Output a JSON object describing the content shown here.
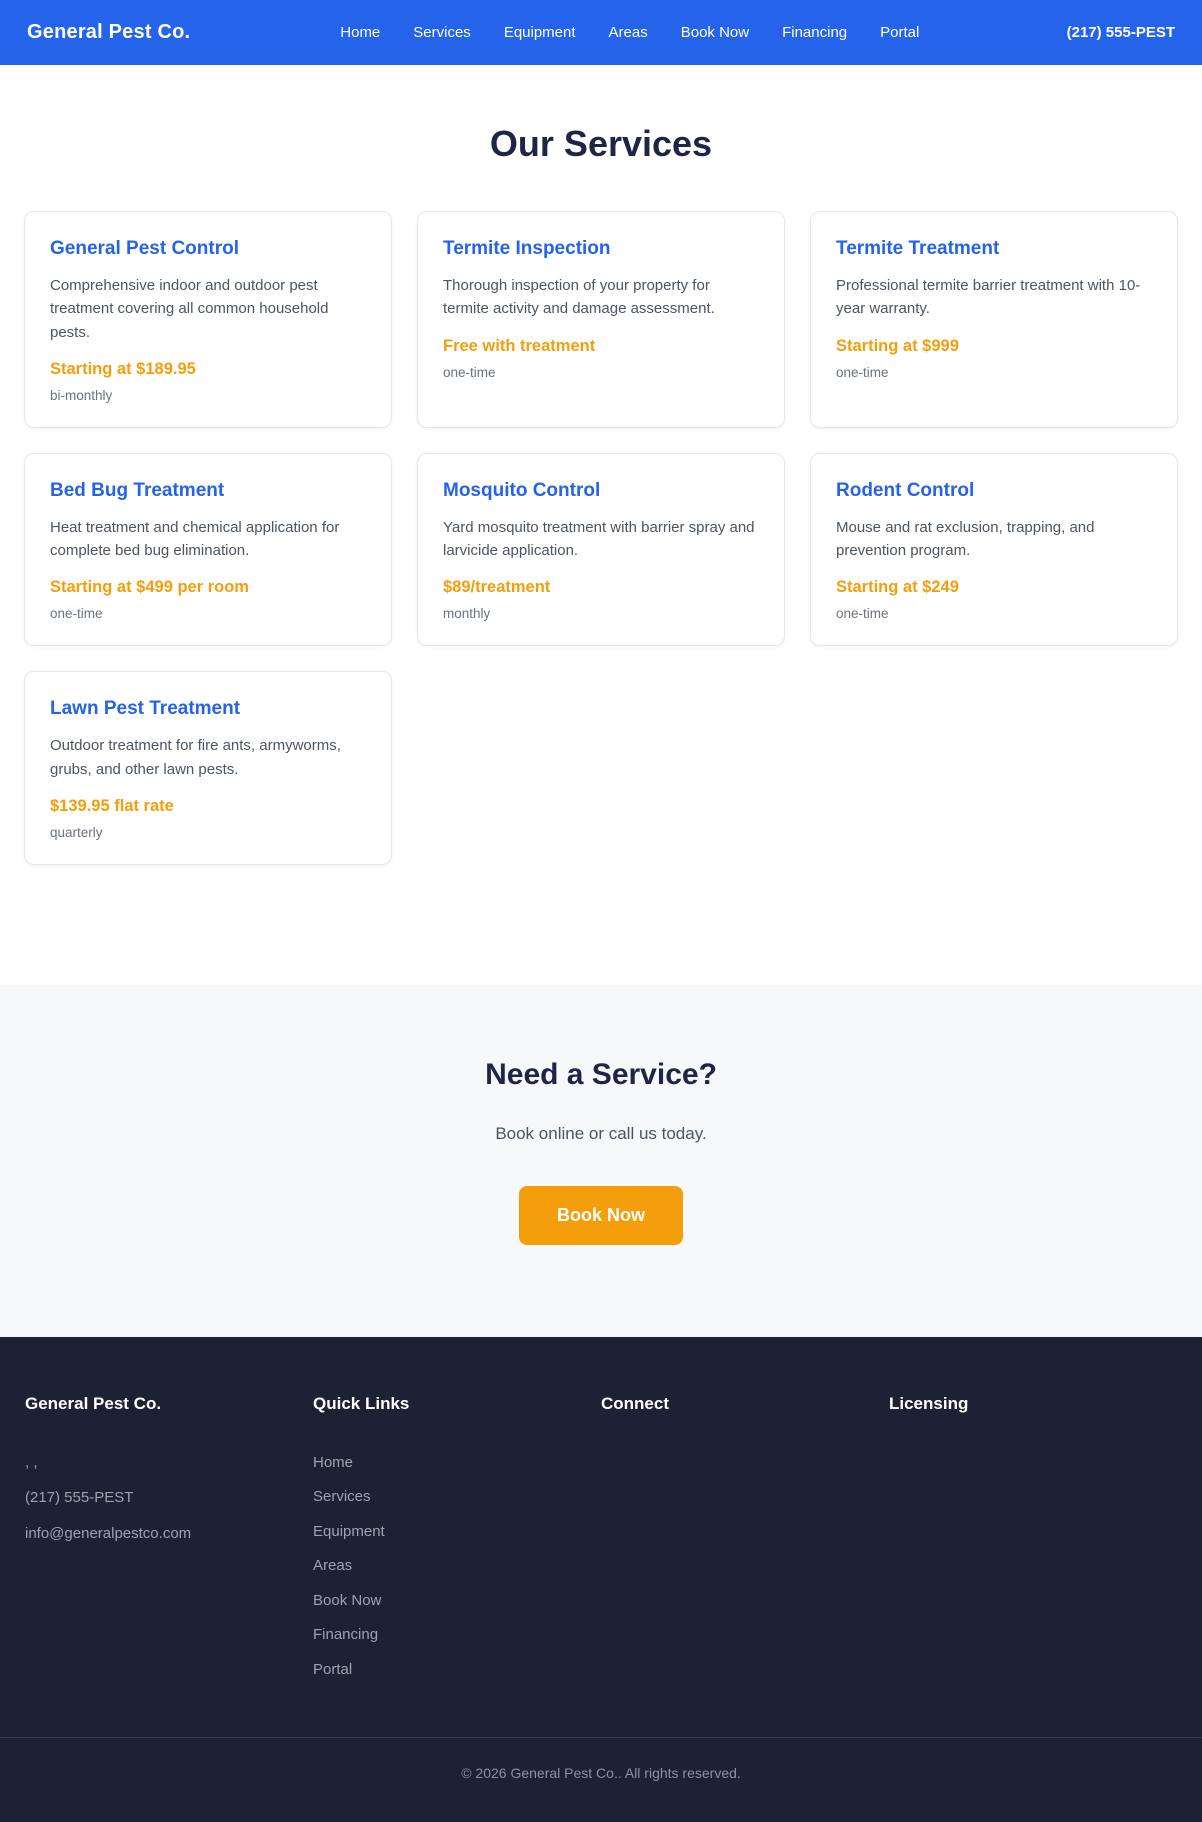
{
  "colors": {
    "header_blue": "#2563eb",
    "accent_orange": "#f59e0b",
    "heading_navy": "#1f2544",
    "footer_dark": "#1c2233"
  },
  "header": {
    "brand": "General Pest Co.",
    "nav": [
      "Home",
      "Services",
      "Equipment",
      "Areas",
      "Book Now",
      "Financing",
      "Portal"
    ],
    "phone": "(217) 555-PEST"
  },
  "page_title": "Our Services",
  "services": [
    {
      "name": "General Pest Control",
      "description": "Comprehensive indoor and outdoor pest treatment covering all common household pests.",
      "price": "Starting at $189.95",
      "frequency": "bi-monthly"
    },
    {
      "name": "Termite Inspection",
      "description": "Thorough inspection of your property for termite activity and damage assessment.",
      "price": "Free with treatment",
      "frequency": "one-time"
    },
    {
      "name": "Termite Treatment",
      "description": "Professional termite barrier treatment with 10-year warranty.",
      "price": "Starting at $999",
      "frequency": "one-time"
    },
    {
      "name": "Bed Bug Treatment",
      "description": "Heat treatment and chemical application for complete bed bug elimination.",
      "price": "Starting at $499 per room",
      "frequency": "one-time"
    },
    {
      "name": "Mosquito Control",
      "description": "Yard mosquito treatment with barrier spray and larvicide application.",
      "price": "$89/treatment",
      "frequency": "monthly"
    },
    {
      "name": "Rodent Control",
      "description": "Mouse and rat exclusion, trapping, and prevention program.",
      "price": "Starting at $249",
      "frequency": "one-time"
    },
    {
      "name": "Lawn Pest Treatment",
      "description": "Outdoor treatment for fire ants, armyworms, grubs, and other lawn pests.",
      "price": "$139.95 flat rate",
      "frequency": "quarterly"
    }
  ],
  "cta": {
    "title": "Need a Service?",
    "subtitle": "Book online or call us today.",
    "button": "Book Now"
  },
  "footer": {
    "brand_heading": "General Pest Co.",
    "address": ", ,",
    "phone": "(217) 555-PEST",
    "email": "info@generalpestco.com",
    "quick_links_heading": "Quick Links",
    "quick_links": [
      "Home",
      "Services",
      "Equipment",
      "Areas",
      "Book Now",
      "Financing",
      "Portal"
    ],
    "connect_heading": "Connect",
    "licensing_heading": "Licensing",
    "copyright": "© 2026 General Pest Co.. All rights reserved."
  }
}
